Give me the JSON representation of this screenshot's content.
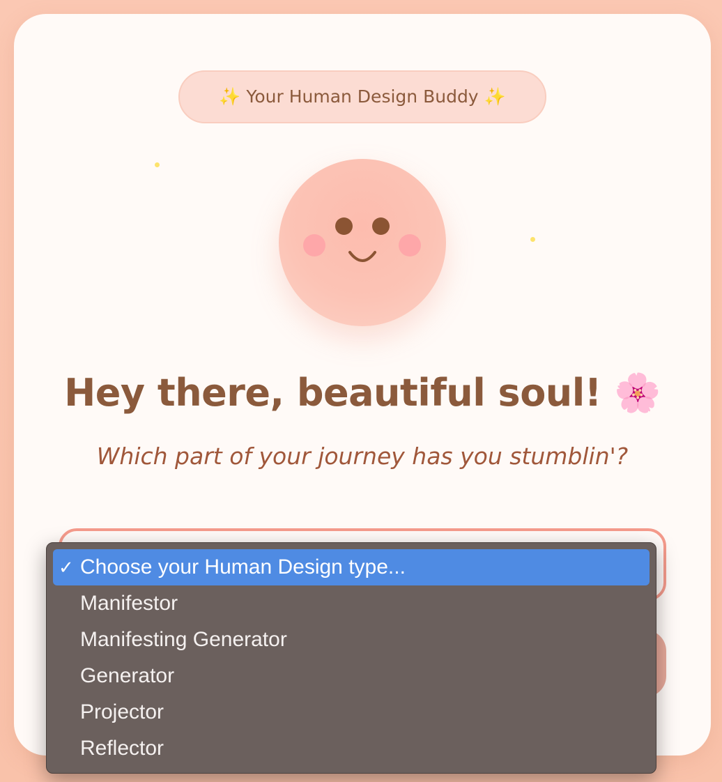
{
  "badge": {
    "text": "✨ Your Human Design Buddy ✨"
  },
  "mascot": {
    "icon": "smiling-face-icon"
  },
  "heading": "Hey there, beautiful soul! 🌸",
  "subheading": "Which part of your journey has you stumblin'?",
  "type_select": {
    "selected": "Choose your Human Design type...",
    "check_glyph": "✓",
    "options": [
      "Choose your Human Design type...",
      "Manifestor",
      "Manifesting Generator",
      "Generator",
      "Projector",
      "Reflector"
    ]
  },
  "colors": {
    "accent": "#8b5a3c",
    "select_border": "#f59b8c",
    "highlight": "#4f8be3"
  }
}
